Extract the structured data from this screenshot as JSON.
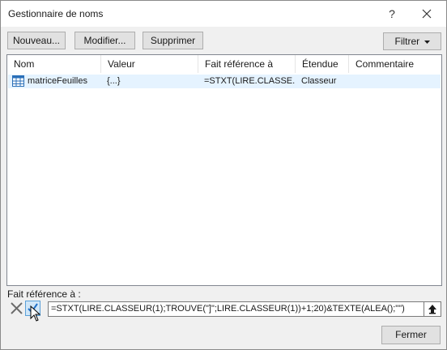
{
  "window": {
    "title": "Gestionnaire de noms",
    "help_glyph": "?"
  },
  "toolbar": {
    "new_label": "Nouveau...",
    "edit_label": "Modifier...",
    "delete_label": "Supprimer",
    "filter_label": "Filtrer"
  },
  "list": {
    "columns": [
      "Nom",
      "Valeur",
      "Fait référence à",
      "Étendue",
      "Commentaire"
    ],
    "rows": [
      {
        "icon": "named-range-grid-icon",
        "name": "matriceFeuilles",
        "value": "{...}",
        "refers_to": "=STXT(LIRE.CLASSE...",
        "scope": "Classeur",
        "comment": ""
      }
    ]
  },
  "reference": {
    "label": "Fait référence à :",
    "formula": "=STXT(LIRE.CLASSEUR(1);TROUVE(\"]\";LIRE.CLASSEUR(1))+1;20)&TEXTE(ALEA();\"\")"
  },
  "footer": {
    "close_label": "Fermer"
  },
  "colors": {
    "dialog_bg": "#f0f0f0",
    "selected_row": "#e5f3ff",
    "accent": "#1e6fc8"
  }
}
